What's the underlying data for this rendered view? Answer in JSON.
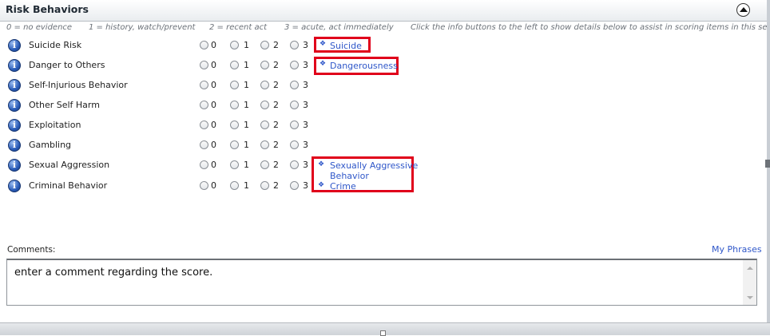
{
  "header": {
    "title": "Risk Behaviors"
  },
  "legend": {
    "no_evidence": "0 = no evidence",
    "history": "1 = history, watch/prevent",
    "recent": "2 = recent act",
    "acute": "3 = acute, act immediately",
    "instructions": "Click the info buttons to the left to show details below to assist in scoring items in this section."
  },
  "score_options": [
    "0",
    "1",
    "2",
    "3"
  ],
  "rows": [
    {
      "label": "Suicide Risk"
    },
    {
      "label": "Danger to Others"
    },
    {
      "label": "Self-Injurious Behavior"
    },
    {
      "label": "Other Self Harm"
    },
    {
      "label": "Exploitation"
    },
    {
      "label": "Gambling"
    },
    {
      "label": "Sexual Aggression"
    },
    {
      "label": "Criminal Behavior"
    }
  ],
  "links": {
    "suicide": "Suicide",
    "dangerousness": "Dangerousness",
    "sexually_aggressive_1": "Sexually Aggressive",
    "sexually_aggressive_2": "Behavior",
    "crime": "Crime"
  },
  "comments": {
    "label": "Comments:",
    "my_phrases": "My Phrases",
    "value": "enter a comment regarding the score."
  }
}
